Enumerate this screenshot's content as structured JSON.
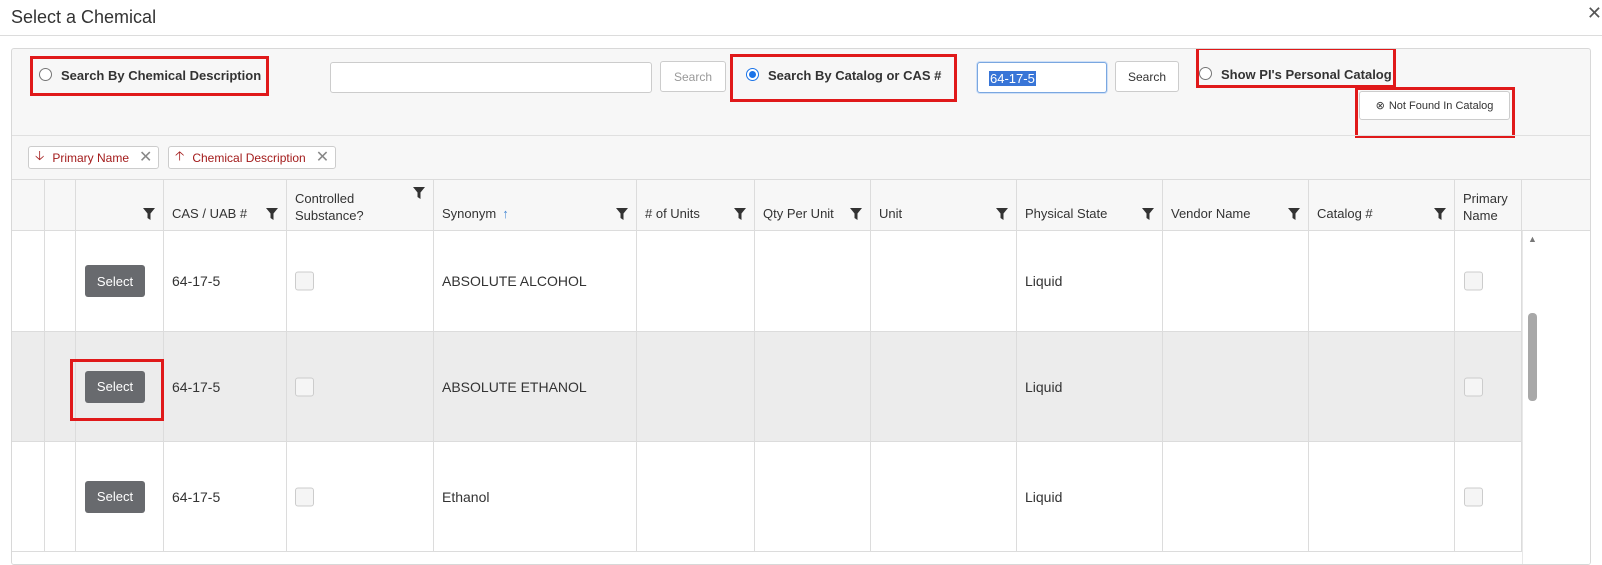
{
  "dialog": {
    "title": "Select a Chemical",
    "close_glyph": "✕"
  },
  "search": {
    "option_description_label": "Search By Chemical Description",
    "description_value": "",
    "description_search_label": "Search",
    "option_catalog_label": "Search By Catalog or CAS #",
    "catalog_value": "64-17-5",
    "catalog_search_label": "Search",
    "option_personal_label": "Show PI's Personal Catalog",
    "not_found_label": "Not Found In Catalog",
    "not_found_icon": "⊗",
    "selected_option": "catalog"
  },
  "sort_chips": [
    {
      "arrow": "🡣",
      "label": "Primary Name",
      "remove": "✕"
    },
    {
      "arrow": "🡡",
      "label": "Chemical Description",
      "remove": "✕"
    }
  ],
  "columns": {
    "cas": "CAS / UAB #",
    "controlled_line1": "Controlled",
    "controlled_line2": "Substance?",
    "synonym": "Synonym",
    "synonym_sort": "↑",
    "units": "# of Units",
    "qty": "Qty Per Unit",
    "unit": "Unit",
    "state": "Physical State",
    "vendor": "Vendor Name",
    "catalog": "Catalog #",
    "primary_line1": "Primary",
    "primary_line2": "Name"
  },
  "rows": [
    {
      "select": "Select",
      "cas": "64-17-5",
      "synonym": "ABSOLUTE ALCOHOL",
      "units": "",
      "qty": "",
      "unit": "",
      "state": "Liquid",
      "vendor": "",
      "catalog": ""
    },
    {
      "select": "Select",
      "cas": "64-17-5",
      "synonym": "ABSOLUTE ETHANOL",
      "units": "",
      "qty": "",
      "unit": "",
      "state": "Liquid",
      "vendor": "",
      "catalog": ""
    },
    {
      "select": "Select",
      "cas": "64-17-5",
      "synonym": "Ethanol",
      "units": "",
      "qty": "",
      "unit": "",
      "state": "Liquid",
      "vendor": "",
      "catalog": ""
    }
  ],
  "colors": {
    "highlight_box": "#e0191a",
    "select_button": "#686a6e",
    "radio_checked": "#1a73e8",
    "sort_chip_text": "#a31b1b"
  }
}
